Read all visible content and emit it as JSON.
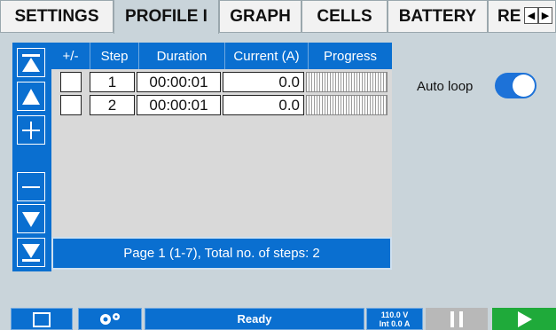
{
  "tabs": [
    {
      "label": "SETTINGS",
      "active": false
    },
    {
      "label": "PROFILE I",
      "active": true
    },
    {
      "label": "GRAPH",
      "active": false
    },
    {
      "label": "CELLS",
      "active": false
    },
    {
      "label": "BATTERY",
      "active": false
    },
    {
      "label": "RE",
      "active": false
    }
  ],
  "tab_arrows": {
    "left": "◀",
    "right": "▶"
  },
  "table": {
    "columns": [
      "+/-",
      "Step",
      "Duration",
      "Current (A)",
      "Progress"
    ],
    "rows": [
      {
        "step": "1",
        "duration": "00:00:01",
        "current": "0.0"
      },
      {
        "step": "2",
        "duration": "00:00:01",
        "current": "0.0"
      }
    ],
    "footer": "Page 1 (1-7), Total no. of steps: 2"
  },
  "side_nav": [
    "first-page-icon",
    "up-arrow-icon",
    "plus-icon",
    "minus-icon",
    "down-arrow-icon",
    "last-page-icon"
  ],
  "autoloop": {
    "label": "Auto loop",
    "enabled": true
  },
  "bottom": {
    "status": "Ready",
    "voltage": "110.0 V",
    "current": "Int 0.0 A",
    "icons": [
      "folder-icon",
      "gears-icon",
      "pause-icon",
      "play-icon"
    ]
  },
  "colors": {
    "accent": "#0a6fd0",
    "toggle": "#1d72d8",
    "play": "#1faa3a",
    "background": "#c9d4da"
  }
}
